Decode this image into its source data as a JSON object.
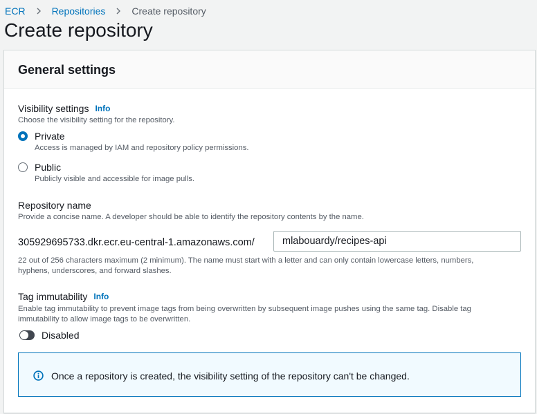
{
  "breadcrumb": {
    "items": [
      "ECR",
      "Repositories",
      "Create repository"
    ]
  },
  "page": {
    "title": "Create repository"
  },
  "general_settings": {
    "heading": "General settings",
    "visibility": {
      "label": "Visibility settings",
      "info": "Info",
      "description": "Choose the visibility setting for the repository.",
      "options": [
        {
          "label": "Private",
          "description": "Access is managed by IAM and repository policy permissions.",
          "selected": true
        },
        {
          "label": "Public",
          "description": "Publicly visible and accessible for image pulls.",
          "selected": false
        }
      ]
    },
    "repository_name": {
      "label": "Repository name",
      "description": "Provide a concise name. A developer should be able to identify the repository contents by the name.",
      "prefix": "305929695733.dkr.ecr.eu-central-1.amazonaws.com/",
      "value": "mlabouardy/recipes-api",
      "constraint_line1": "22 out of 256 characters maximum (2 minimum). The name must start with a letter and can only contain lowercase letters, numbers,",
      "constraint_line2": "hyphens, underscores, and forward slashes."
    },
    "tag_immutability": {
      "label": "Tag immutability",
      "info": "Info",
      "description_line1": "Enable tag immutability to prevent image tags from being overwritten by subsequent image pushes using the same tag. Disable tag",
      "description_line2": "immutability to allow image tags to be overwritten.",
      "toggle_label": "Disabled",
      "enabled": false
    },
    "alert": {
      "text": "Once a repository is created, the visibility setting of the repository can't be changed."
    }
  },
  "colors": {
    "link": "#0073bb",
    "radio_selected": "#0073bb",
    "toggle_off": "#414750",
    "alert_border": "#0073bb",
    "alert_bg": "#f1faff"
  }
}
